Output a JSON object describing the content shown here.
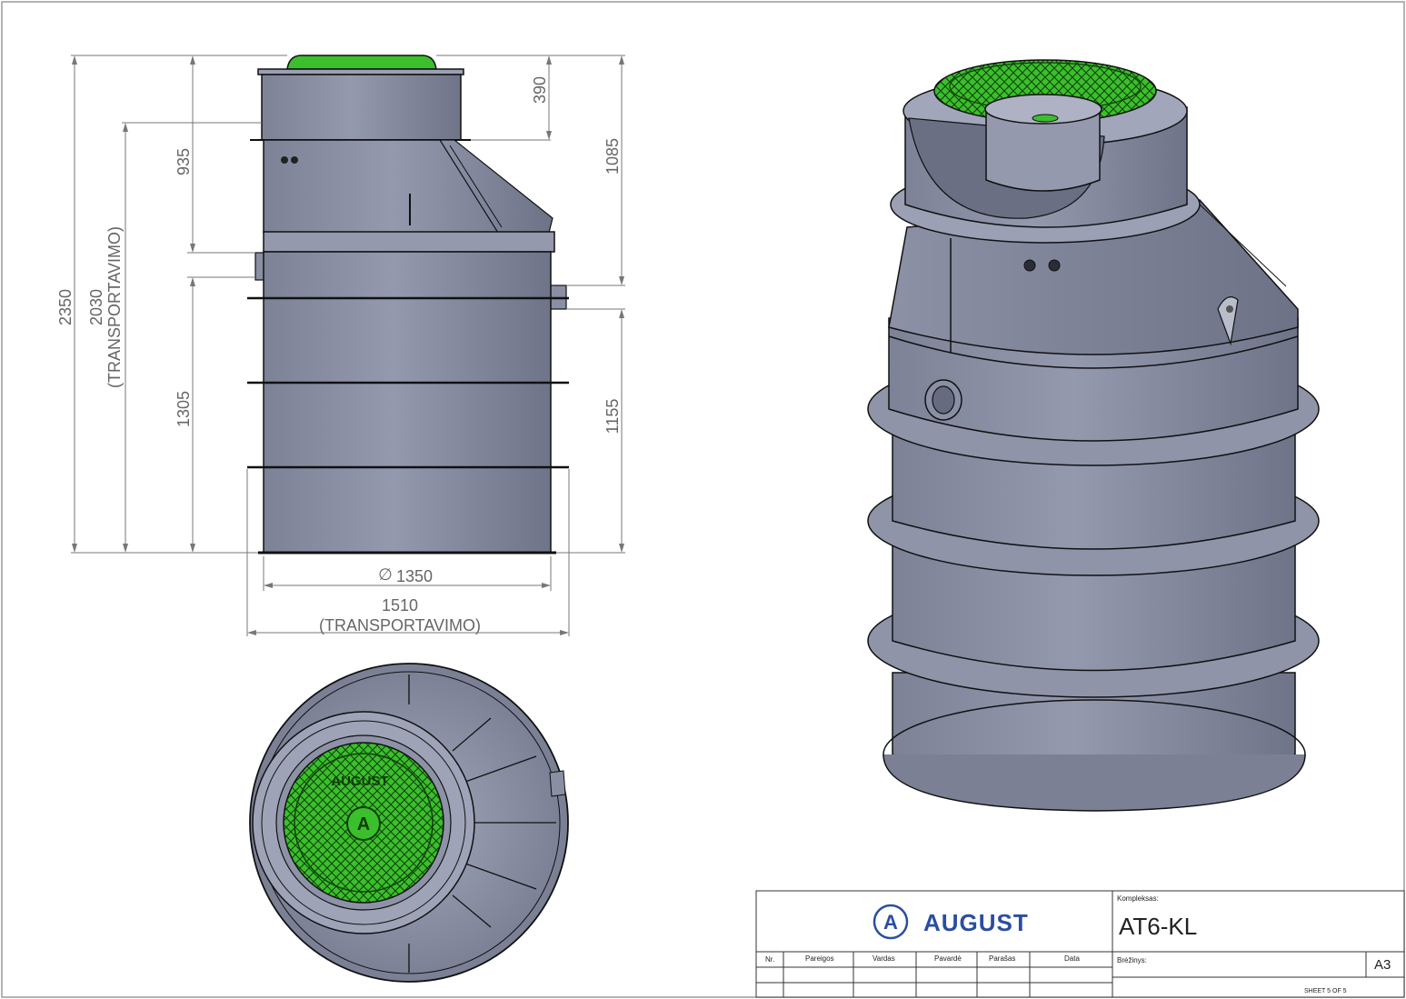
{
  "dimensions": {
    "total_height": "2350",
    "transport_height": "2030",
    "transport_height_note": "(TRANSPORTAVIMO)",
    "upper_section": "935",
    "lower_section": "1305",
    "top_riser": "390",
    "inlet_height": "1085",
    "outlet_height": "1155",
    "diameter": "1350",
    "diameter_symbol": "∅",
    "transport_width": "1510",
    "transport_width_note": "(TRANSPORTAVIMO)"
  },
  "cover_text": {
    "brand": "AUGUST",
    "logo_letter": "A"
  },
  "title_block": {
    "brand": "AUGUST",
    "logo_letter": "A",
    "kompleksas_label": "Kompleksas:",
    "kompleksas_value": "AT6-KL",
    "breziny_label": "Brėžinys:",
    "paper_size": "A3",
    "sheet": "SHEET 5 OF 5",
    "columns": [
      "Nr.",
      "Pareigos",
      "Vardas",
      "Pavardė",
      "Parašas",
      "Data"
    ]
  },
  "colors": {
    "tank": "#8a8fa4",
    "tank_dark": "#6c7188",
    "cover": "#3bbf2c",
    "brand_blue": "#2a4ea0",
    "line": "#111111",
    "dim_line": "#777777"
  }
}
